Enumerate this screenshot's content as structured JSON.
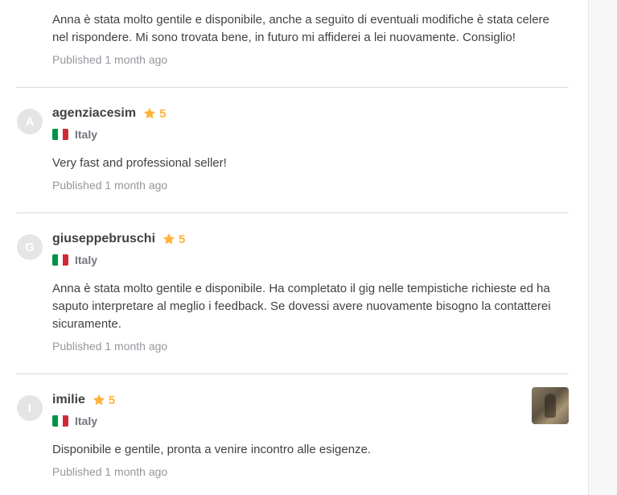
{
  "top_review": {
    "text": "Anna è stata molto gentile e disponibile, anche a seguito di eventuali modifiche è stata celere nel rispondere. Mi sono trovata bene, in futuro mi affiderei a lei nuovamente. Consiglio!",
    "published": "Published 1 month ago"
  },
  "reviews": [
    {
      "avatar_letter": "A",
      "username": "agenziacesim",
      "rating": "5",
      "country": "Italy",
      "text": "Very fast and professional seller!",
      "published": "Published 1 month ago",
      "has_image": false
    },
    {
      "avatar_letter": "G",
      "username": "giuseppebruschi",
      "rating": "5",
      "country": "Italy",
      "text": "Anna è stata molto gentile e disponibile. Ha completato il gig nelle tempistiche richieste ed ha saputo interpretare al meglio i feedback. Se dovessi avere nuovamente bisogno la contatterei sicuramente.",
      "published": "Published 1 month ago",
      "has_image": false
    },
    {
      "avatar_letter": "I",
      "username": "imilie",
      "rating": "5",
      "country": "Italy",
      "text": "Disponibile e gentile, pronta a venire incontro alle esigenze.",
      "published": "Published 1 month ago",
      "has_image": true
    }
  ],
  "colors": {
    "star": "#ffb33e",
    "flag_green": "#009246",
    "flag_white": "#ffffff",
    "flag_red": "#ce2b37"
  },
  "icons": {
    "star": "star-icon",
    "flag": "italy-flag-icon"
  }
}
